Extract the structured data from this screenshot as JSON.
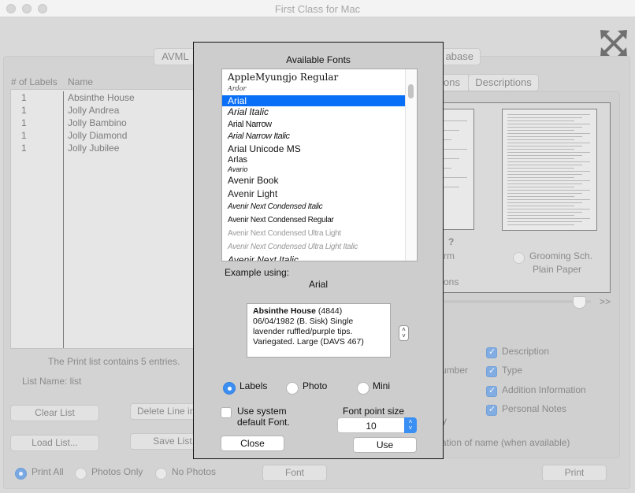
{
  "window": {
    "title": "First Class for Mac"
  },
  "colors": {
    "accent": "#0a6ff7",
    "selection": "#0a6ff7",
    "dialog_bg": "#cdcdcd",
    "window_bg": "#d9d9d9"
  },
  "top_tabs": {
    "avml": "AVML",
    "database_partial": "abase"
  },
  "sub_tabs": {
    "partial": "ons",
    "descriptions": "Descriptions"
  },
  "print_list": {
    "headers": {
      "count": "# of Labels",
      "name": "Name"
    },
    "rows": [
      {
        "count": "1",
        "name": "Absinthe House"
      },
      {
        "count": "1",
        "name": "Jolly Andrea"
      },
      {
        "count": "1",
        "name": "Jolly Bambino"
      },
      {
        "count": "1",
        "name": "Jolly Diamond"
      },
      {
        "count": "1",
        "name": "Jolly Jubilee"
      }
    ],
    "summary": "The Print list contains 5 entries.",
    "list_name": "List Name: list"
  },
  "list_buttons": {
    "clear": "Clear List",
    "delete_partial": "Delete Line in",
    "load": "Load List...",
    "save_partial": "Save List."
  },
  "photo_options": {
    "items": [
      {
        "label": "Print All",
        "selected": true
      },
      {
        "label": "Photos Only",
        "selected": false
      },
      {
        "label": "No Photos",
        "selected": false
      }
    ]
  },
  "bottom_buttons": {
    "font": "Font",
    "print": "Print"
  },
  "preview": {
    "question_mark": "?",
    "left_partial_1": "rm",
    "left_partial_2": "ons",
    "grooming_line1": "Grooming Sch.",
    "grooming_line2": "Plain Paper",
    "next_label": ">>",
    "slider_position": 0.92
  },
  "include_options": {
    "partial_number": "umber",
    "partial_y": "y",
    "partial_name": "ation of name (when available)",
    "checks": [
      {
        "label": "Description",
        "checked": true
      },
      {
        "label": "Type",
        "checked": true
      },
      {
        "label": "Addition Information",
        "checked": true
      },
      {
        "label": "Personal Notes",
        "checked": true
      }
    ]
  },
  "font_dialog": {
    "heading": "Available Fonts",
    "fonts": [
      {
        "name": "AppleMyungjo Regular",
        "selected": false
      },
      {
        "name": "Ardor",
        "selected": false
      },
      {
        "name": "Arial",
        "selected": true
      },
      {
        "name": "Arial Italic",
        "selected": false
      },
      {
        "name": "Arial Narrow",
        "selected": false
      },
      {
        "name": "Arial Narrow Italic",
        "selected": false
      },
      {
        "name": "Arial Unicode MS",
        "selected": false
      },
      {
        "name": "Arlas",
        "selected": false
      },
      {
        "name": "Avario",
        "selected": false
      },
      {
        "name": "Avenir Book",
        "selected": false
      },
      {
        "name": "Avenir Light",
        "selected": false
      },
      {
        "name": "Avenir Next Condensed Italic",
        "selected": false
      },
      {
        "name": "Avenir Next Condensed Regular",
        "selected": false
      },
      {
        "name": "Avenir Next Condensed Ultra Light",
        "selected": false
      },
      {
        "name": "Avenir Next Condensed Ultra Light Italic",
        "selected": false
      },
      {
        "name": "Avenir Next Italic",
        "selected": false
      }
    ],
    "example_label": "Example using:",
    "example_font": "Arial",
    "example_text": {
      "bold": "Absinthe House",
      "rest": " (4844) 06/04/1982 (B. Sisk) Single lavender ruffled/purple tips. Variegated. Large (DAVS 467)"
    },
    "modes": [
      {
        "label": "Labels",
        "selected": true
      },
      {
        "label": "Photo",
        "selected": false
      },
      {
        "label": "Mini",
        "selected": false
      }
    ],
    "use_system_font": {
      "line1": "Use system",
      "line2": "default Font.",
      "checked": false
    },
    "point_size": {
      "label": "Font point size",
      "value": "10"
    },
    "close": "Close",
    "use": "Use"
  }
}
